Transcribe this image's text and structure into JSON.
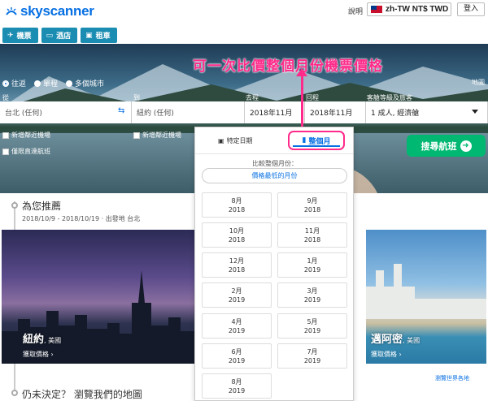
{
  "header": {
    "logo_text": "skyscanner",
    "help": "說明",
    "locale": "zh-TW NT$ TWD",
    "login": "登入"
  },
  "tabs": [
    {
      "icon": "plane-icon",
      "label": "機票"
    },
    {
      "icon": "bed-icon",
      "label": "酒店"
    },
    {
      "icon": "car-icon",
      "label": "租車"
    }
  ],
  "annotation": "可一次比價整個月份機票價格",
  "search": {
    "trip_types": [
      "往返",
      "單程",
      "多個城市"
    ],
    "map_link": "地圖",
    "labels": {
      "from": "從",
      "to": "到",
      "depart": "去程",
      "return": "回程",
      "pax": "客艙等級及旅客"
    },
    "from_value": "台北 (任何)",
    "to_value": "紐約 (任何)",
    "depart_value": "2018年11月",
    "return_value": "2018年11月",
    "pax_value": "1 成人, 經濟艙",
    "nearby_from": "新增鄰近機場",
    "nearby_to": "新增鄰近機場",
    "direct_only": "僅限直達航班",
    "submit": "搜尋航班"
  },
  "recommend": {
    "title": "為您推薦",
    "subtitle": "2018/10/9 - 2018/10/19 · 出發地 台北",
    "cards": [
      {
        "city": "紐約",
        "country": "美國",
        "cta": "獲取價格"
      },
      {
        "city": "邁阿密",
        "country": "美國",
        "cta": "獲取價格"
      }
    ],
    "world_map": "瀏覽世界各地",
    "undecided": "仍未決定？ 瀏覽我們的地圖"
  },
  "dropdown": {
    "tab_specific": "特定日期",
    "tab_month": "整個月",
    "compare": "比較整個月份：",
    "cheapest": "價格最低的月份",
    "months": [
      {
        "m": "8月",
        "y": "2018"
      },
      {
        "m": "9月",
        "y": "2018"
      },
      {
        "m": "10月",
        "y": "2018"
      },
      {
        "m": "11月",
        "y": "2018"
      },
      {
        "m": "12月",
        "y": "2018"
      },
      {
        "m": "1月",
        "y": "2019"
      },
      {
        "m": "2月",
        "y": "2019"
      },
      {
        "m": "3月",
        "y": "2019"
      },
      {
        "m": "4月",
        "y": "2019"
      },
      {
        "m": "5月",
        "y": "2019"
      },
      {
        "m": "6月",
        "y": "2019"
      },
      {
        "m": "7月",
        "y": "2019"
      },
      {
        "m": "8月",
        "y": "2019"
      }
    ]
  },
  "colors": {
    "brand": "#0770e3",
    "tab": "#1b8db2",
    "cta": "#00b872",
    "annotation": "#ff2a8a"
  }
}
